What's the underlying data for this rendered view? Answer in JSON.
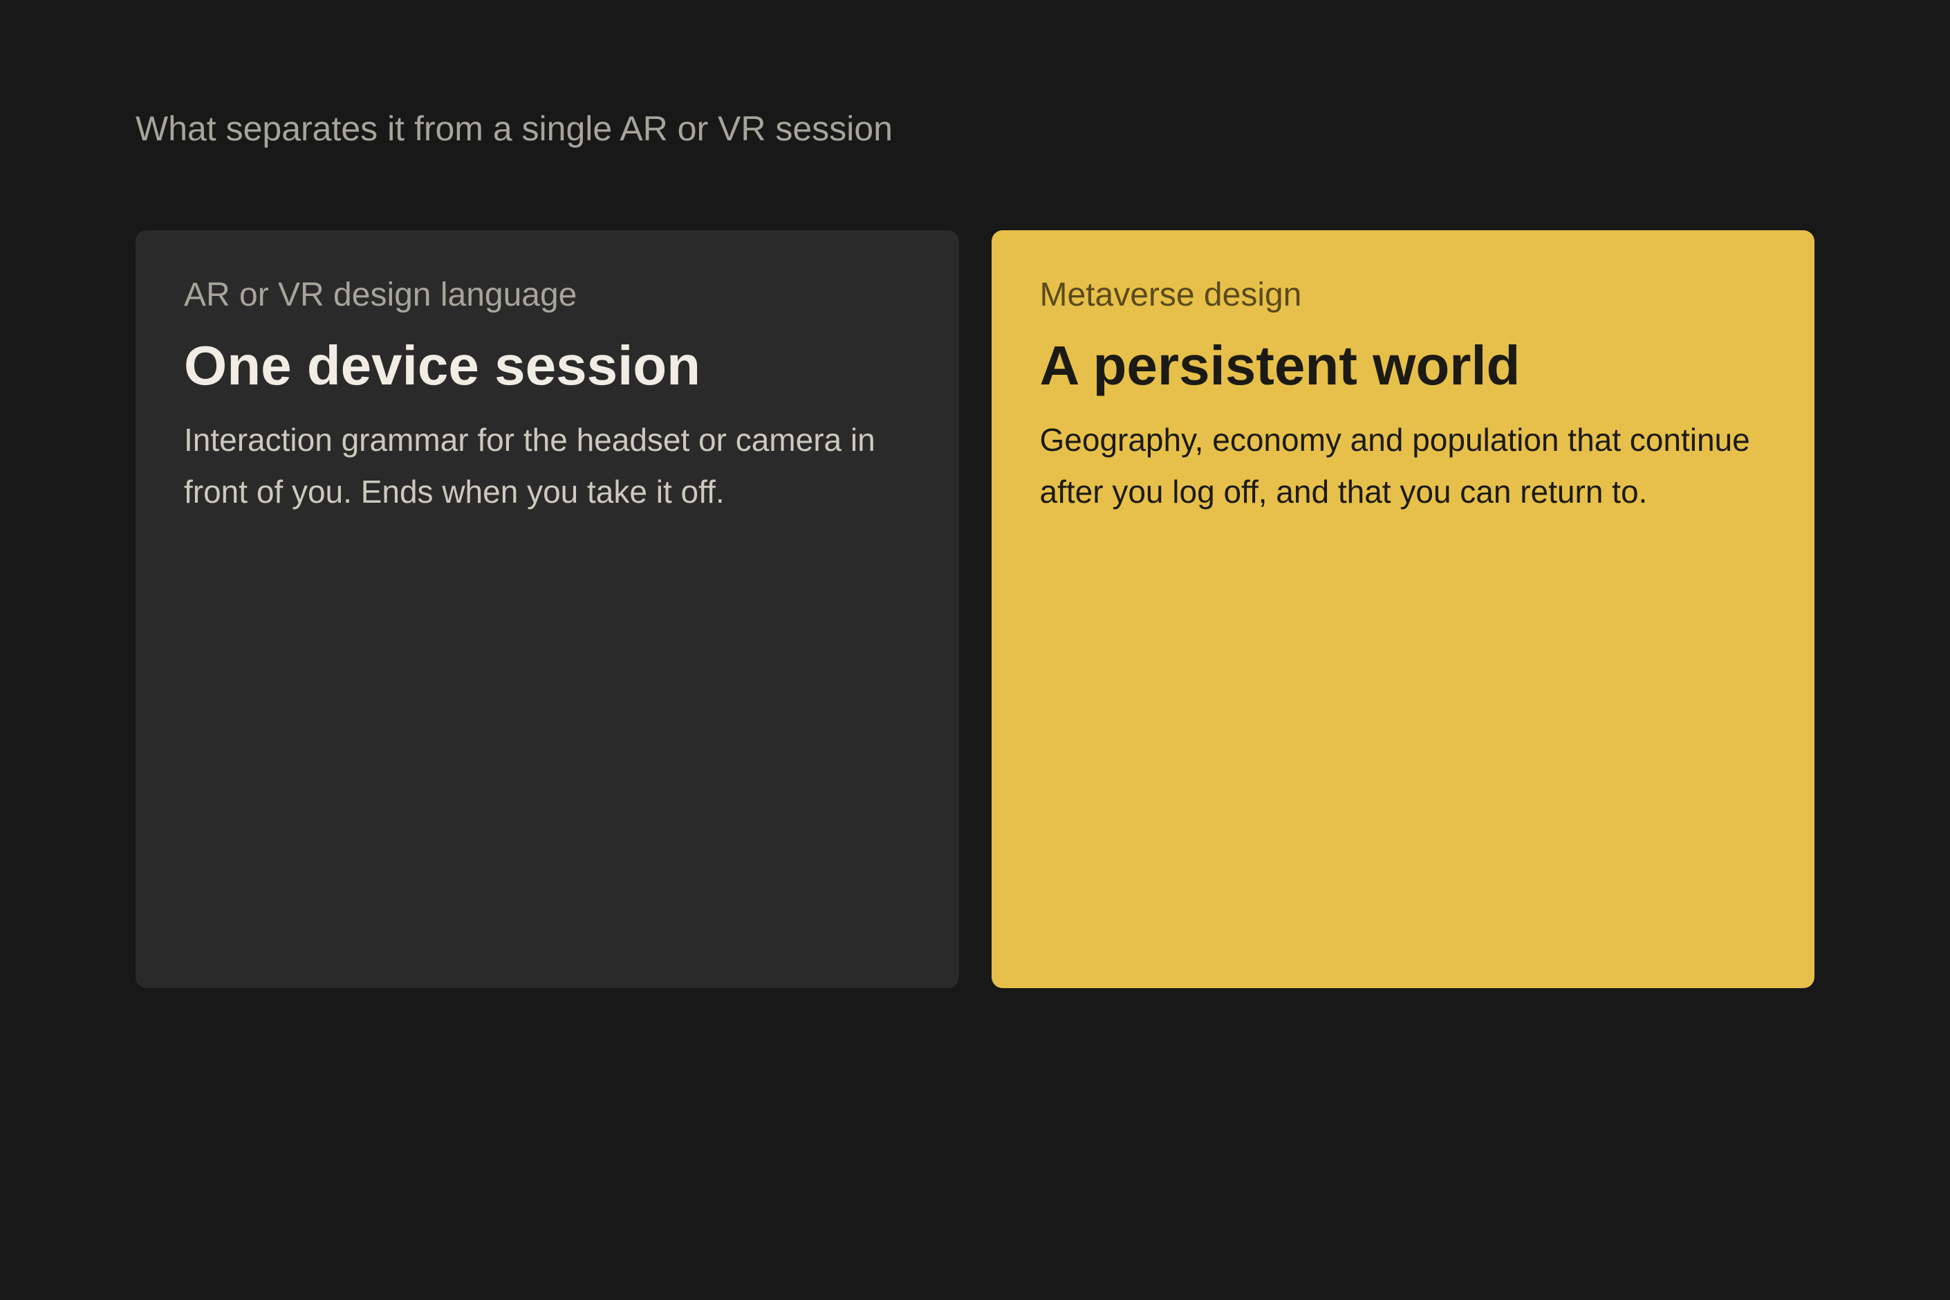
{
  "section": {
    "heading": "What separates it from a single AR or VR session"
  },
  "cards": [
    {
      "eyebrow": "AR or VR design language",
      "title": "One device session",
      "body": "Interaction grammar for the headset or camera in front of you. Ends when you take it off.",
      "background": "#2a2a2a"
    },
    {
      "eyebrow": "Metaverse design",
      "title": "A persistent world",
      "body": "Geography, economy and population that continue after you log off, and that you can return to.",
      "background": "#e6c04a"
    }
  ]
}
